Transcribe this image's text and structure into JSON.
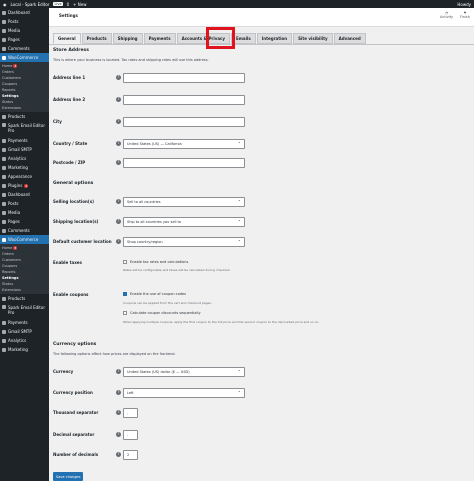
{
  "adminbar": {
    "site": "Local - Spark Editor",
    "live": "Live",
    "count": "0",
    "new": "+ New",
    "howdy": "Howdy"
  },
  "sidebar": {
    "top": [
      {
        "label": "Dashboard"
      },
      {
        "label": "Posts"
      },
      {
        "label": "Media"
      },
      {
        "label": "Pages"
      },
      {
        "label": "Comments"
      }
    ],
    "woo": {
      "label": "WooCommerce"
    },
    "sub": [
      {
        "label": "Home",
        "badge": "3"
      },
      {
        "label": "Orders"
      },
      {
        "label": "Customers"
      },
      {
        "label": "Coupons"
      },
      {
        "label": "Reports"
      },
      {
        "label": "Settings"
      },
      {
        "label": "Status"
      },
      {
        "label": "Extensions"
      }
    ],
    "bottom": [
      {
        "label": "Products"
      },
      {
        "label": "Spark Email Editor Pro"
      },
      {
        "label": "Payments"
      },
      {
        "label": "Gmail SMTP"
      },
      {
        "label": "Analytics"
      },
      {
        "label": "Marketing"
      },
      {
        "label": "Appearance"
      },
      {
        "label": "Plugins",
        "badge": "3"
      }
    ],
    "top2": [
      {
        "label": "Dashboard"
      },
      {
        "label": "Posts"
      },
      {
        "label": "Media"
      },
      {
        "label": "Pages"
      },
      {
        "label": "Comments"
      }
    ],
    "woo2": {
      "label": "WooCommerce"
    },
    "sub2": [
      {
        "label": "Home",
        "badge": "3"
      },
      {
        "label": "Orders"
      },
      {
        "label": "Customers"
      },
      {
        "label": "Coupons"
      },
      {
        "label": "Reports"
      },
      {
        "label": "Settings"
      },
      {
        "label": "Status"
      },
      {
        "label": "Extensions"
      }
    ],
    "bottom2": [
      {
        "label": "Products"
      },
      {
        "label": "Spark Email Editor Pro"
      },
      {
        "label": "Payments"
      },
      {
        "label": "Gmail SMTP"
      },
      {
        "label": "Analytics"
      },
      {
        "label": "Marketing"
      }
    ]
  },
  "topbar": {
    "title": "Settings",
    "activity": "Activity",
    "finish": "Finish"
  },
  "tabs": [
    "General",
    "Products",
    "Shipping",
    "Payments",
    "Accounts & Privacy",
    "Emails",
    "Integration",
    "Site visibility",
    "Advanced"
  ],
  "store": {
    "heading": "Store Address",
    "desc": "This is where your business is located. Tax rates and shipping rates will use this address.",
    "address1": "Address line 1",
    "address2": "Address line 2",
    "city": "City",
    "country_label": "Country / State",
    "country_value": "United States (US) — California",
    "postcode": "Postcode / ZIP"
  },
  "general": {
    "heading": "General options",
    "selling_label": "Selling location(s)",
    "selling_value": "Sell to all countries",
    "shipping_label": "Shipping location(s)",
    "shipping_value": "Ship to all countries you sell to",
    "customer_label": "Default customer location",
    "customer_value": "Shop country/region",
    "taxes_label": "Enable taxes",
    "taxes_cb": "Enable tax rates and calculations",
    "taxes_note": "Rates will be configurable and taxes will be calculated during checkout.",
    "coupons_label": "Enable coupons",
    "coupons_cb": "Enable the use of coupon codes",
    "coupons_note": "Coupons can be applied from the cart and checkout pages.",
    "seq_cb": "Calculate coupon discounts sequentially",
    "seq_note": "When applying multiple coupons, apply the first coupon to the full price and the second coupon to the discounted price and so on."
  },
  "currency": {
    "heading": "Currency options",
    "desc": "The following options affect how prices are displayed on the frontend.",
    "currency_label": "Currency",
    "currency_value": "United States (US) dollar ($ — USD)",
    "position_label": "Currency position",
    "position_value": "Left",
    "thousand_label": "Thousand separator",
    "thousand_value": ",",
    "decimal_label": "Decimal separator",
    "decimal_value": ".",
    "decimals_label": "Number of decimals",
    "decimals_value": "2"
  },
  "save_label": "Save changes"
}
